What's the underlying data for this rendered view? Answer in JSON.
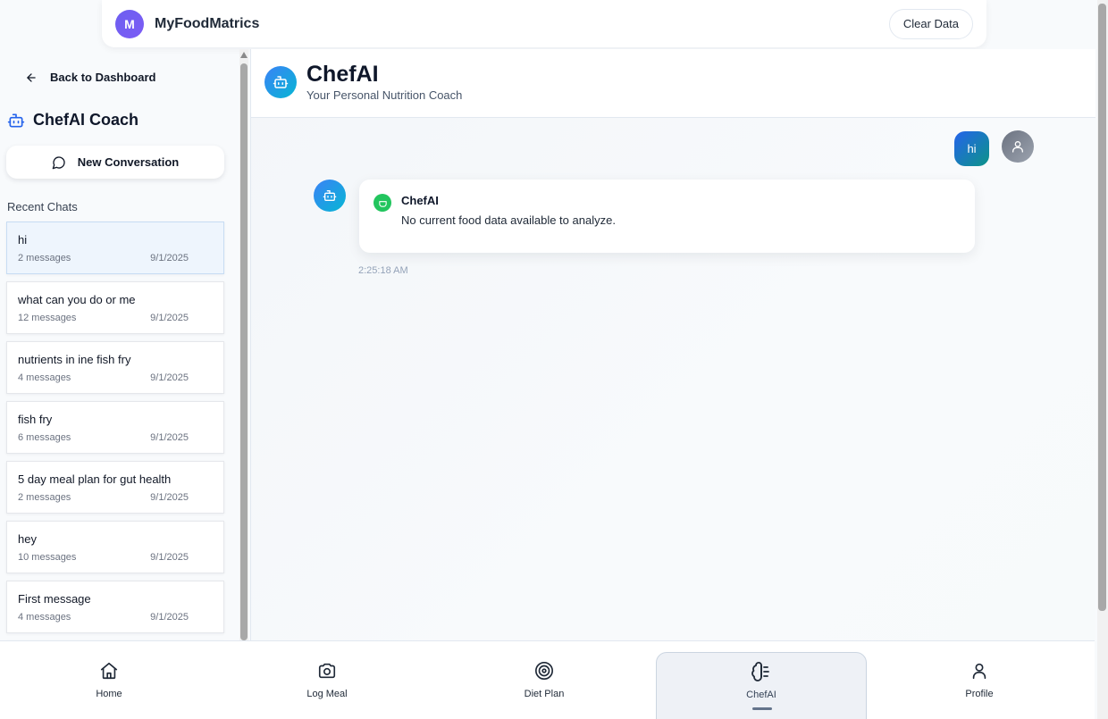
{
  "app": {
    "logo_letter": "M",
    "name": "MyFoodMatrics",
    "clear_label": "Clear Data"
  },
  "sidebar": {
    "back_label": "Back to Dashboard",
    "coach_title": "ChefAI Coach",
    "new_conversation_label": "New Conversation",
    "recent_label": "Recent Chats",
    "chats": [
      {
        "title": "hi",
        "messages": "2 messages",
        "date": "9/1/2025",
        "active": true
      },
      {
        "title": "what can you do or me",
        "messages": "12 messages",
        "date": "9/1/2025"
      },
      {
        "title": "nutrients in ine fish fry",
        "messages": "4 messages",
        "date": "9/1/2025"
      },
      {
        "title": "fish fry",
        "messages": "6 messages",
        "date": "9/1/2025"
      },
      {
        "title": "5 day meal plan for gut health",
        "messages": "2 messages",
        "date": "9/1/2025"
      },
      {
        "title": "hey",
        "messages": "10 messages",
        "date": "9/1/2025"
      },
      {
        "title": "First message",
        "messages": "4 messages",
        "date": "9/1/2025"
      }
    ]
  },
  "chat": {
    "title": "ChefAI",
    "subtitle": "Your Personal Nutrition Coach",
    "user_message": "hi",
    "bot_name": "ChefAI",
    "bot_message": "No current food data available to analyze.",
    "timestamp": "2:25:18 AM"
  },
  "nav": [
    {
      "label": "Home",
      "icon": "home-icon"
    },
    {
      "label": "Log Meal",
      "icon": "camera-icon"
    },
    {
      "label": "Diet Plan",
      "icon": "target-icon"
    },
    {
      "label": "ChefAI",
      "icon": "brain-icon",
      "active": true
    },
    {
      "label": "Profile",
      "icon": "user-icon"
    }
  ],
  "colors": {
    "accent": "#6d5ff0",
    "bot_gradient": "#3b82f6",
    "user_bubble": "#2563eb",
    "badge": "#22c55e"
  }
}
